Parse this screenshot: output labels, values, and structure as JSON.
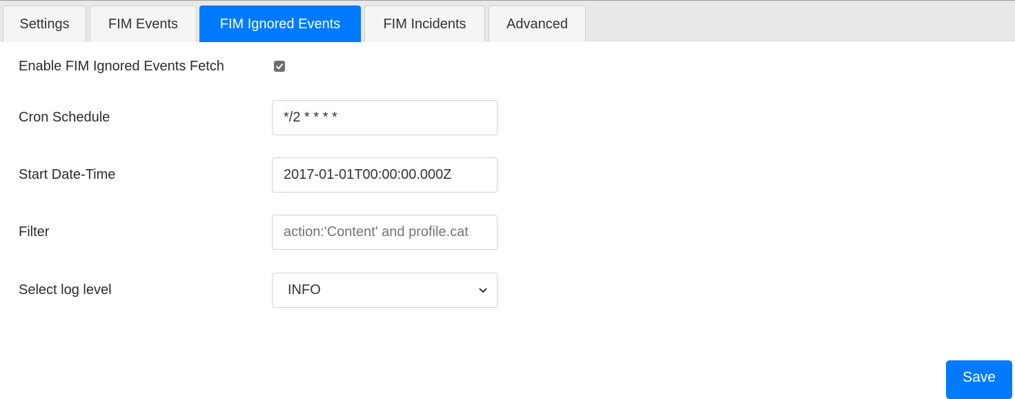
{
  "tabs": [
    {
      "label": "Settings",
      "active": false
    },
    {
      "label": "FIM Events",
      "active": false
    },
    {
      "label": "FIM Ignored Events",
      "active": true
    },
    {
      "label": "FIM Incidents",
      "active": false
    },
    {
      "label": "Advanced",
      "active": false
    }
  ],
  "form": {
    "enable_fetch": {
      "label": "Enable FIM Ignored Events Fetch",
      "checked": true
    },
    "cron_schedule": {
      "label": "Cron Schedule",
      "value": "*/2 * * * *"
    },
    "start_datetime": {
      "label": "Start Date-Time",
      "value": "2017-01-01T00:00:00.000Z"
    },
    "filter": {
      "label": "Filter",
      "placeholder": "action:'Content' and profile.cat"
    },
    "log_level": {
      "label": "Select log level",
      "selected": "INFO"
    }
  },
  "actions": {
    "save_label": "Save"
  },
  "colors": {
    "accent": "#007bff",
    "tabbar_bg": "#e8e8e8",
    "tab_bg": "#f5f5f5"
  }
}
